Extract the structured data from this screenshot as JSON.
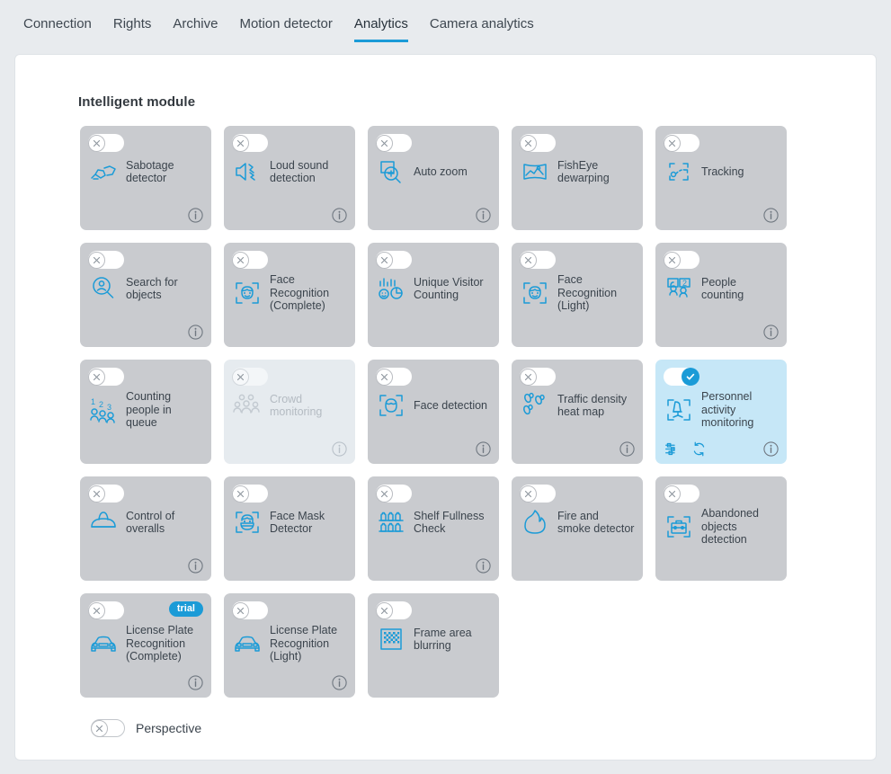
{
  "tabs": [
    {
      "label": "Connection",
      "active": false
    },
    {
      "label": "Rights",
      "active": false
    },
    {
      "label": "Archive",
      "active": false
    },
    {
      "label": "Motion detector",
      "active": false
    },
    {
      "label": "Analytics",
      "active": true
    },
    {
      "label": "Camera analytics",
      "active": false
    }
  ],
  "section": {
    "title": "Intelligent module"
  },
  "colors": {
    "accent": "#1b9bd7",
    "card_off_bg": "#c9cbcf",
    "card_on_bg": "#c6e7f7",
    "card_disabled_bg": "#e6ebef",
    "page_bg": "#e8ebee",
    "text": "#3b444d"
  },
  "modules": [
    {
      "label": "Sabotage detector",
      "icon": "sabotage-detector-icon",
      "state": "off",
      "info": true,
      "trial": false,
      "extras": []
    },
    {
      "label": "Loud sound detection",
      "icon": "loud-sound-icon",
      "state": "off",
      "info": true,
      "trial": false,
      "extras": []
    },
    {
      "label": "Auto zoom",
      "icon": "auto-zoom-icon",
      "state": "off",
      "info": true,
      "trial": false,
      "extras": []
    },
    {
      "label": "FishEye dewarping",
      "icon": "fisheye-dewarping-icon",
      "state": "off",
      "info": false,
      "trial": false,
      "extras": []
    },
    {
      "label": "Tracking",
      "icon": "tracking-icon",
      "state": "off",
      "info": true,
      "trial": false,
      "extras": []
    },
    {
      "label": "Search for objects",
      "icon": "search-objects-icon",
      "state": "off",
      "info": true,
      "trial": false,
      "extras": []
    },
    {
      "label": "Face Recognition (Complete)",
      "icon": "face-recognition-icon",
      "state": "off",
      "info": false,
      "trial": false,
      "extras": []
    },
    {
      "label": "Unique Visitor Counting",
      "icon": "unique-visitor-icon",
      "state": "off",
      "info": false,
      "trial": false,
      "extras": []
    },
    {
      "label": "Face Recognition (Light)",
      "icon": "face-recognition-icon",
      "state": "off",
      "info": false,
      "trial": false,
      "extras": []
    },
    {
      "label": "People counting",
      "icon": "people-counting-icon",
      "state": "off",
      "info": true,
      "trial": false,
      "extras": []
    },
    {
      "label": "Counting people in queue",
      "icon": "counting-queue-icon",
      "state": "off",
      "info": false,
      "trial": false,
      "extras": []
    },
    {
      "label": "Crowd monitoring",
      "icon": "crowd-monitoring-icon",
      "state": "disabled",
      "info": true,
      "trial": false,
      "extras": []
    },
    {
      "label": "Face detection",
      "icon": "face-detection-icon",
      "state": "off",
      "info": true,
      "trial": false,
      "extras": []
    },
    {
      "label": "Traffic density heat map",
      "icon": "heat-map-icon",
      "state": "off",
      "info": true,
      "trial": false,
      "extras": []
    },
    {
      "label": "Personnel activity monitoring",
      "icon": "personnel-activity-icon",
      "state": "on",
      "info": true,
      "trial": false,
      "extras": [
        "settings-sliders-icon",
        "refresh-icon"
      ]
    },
    {
      "label": "Control of overalls",
      "icon": "overalls-icon",
      "state": "off",
      "info": true,
      "trial": false,
      "extras": []
    },
    {
      "label": "Face Mask Detector",
      "icon": "face-mask-icon",
      "state": "off",
      "info": false,
      "trial": false,
      "extras": []
    },
    {
      "label": "Shelf Fullness Check",
      "icon": "shelf-fullness-icon",
      "state": "off",
      "info": true,
      "trial": false,
      "extras": []
    },
    {
      "label": "Fire and smoke detector",
      "icon": "fire-smoke-icon",
      "state": "off",
      "info": false,
      "trial": false,
      "extras": []
    },
    {
      "label": "Abandoned objects detection",
      "icon": "abandoned-objects-icon",
      "state": "off",
      "info": false,
      "trial": false,
      "extras": []
    },
    {
      "label": "License Plate Recognition (Complete)",
      "icon": "license-plate-icon",
      "state": "off",
      "info": true,
      "trial": true,
      "trial_label": "trial",
      "extras": []
    },
    {
      "label": "License Plate Recognition (Light)",
      "icon": "license-plate-icon",
      "state": "off",
      "info": true,
      "trial": false,
      "extras": []
    },
    {
      "label": "Frame area blurring",
      "icon": "frame-blur-icon",
      "state": "off",
      "info": false,
      "trial": false,
      "extras": []
    }
  ],
  "perspective": {
    "label": "Perspective",
    "state": "off"
  }
}
